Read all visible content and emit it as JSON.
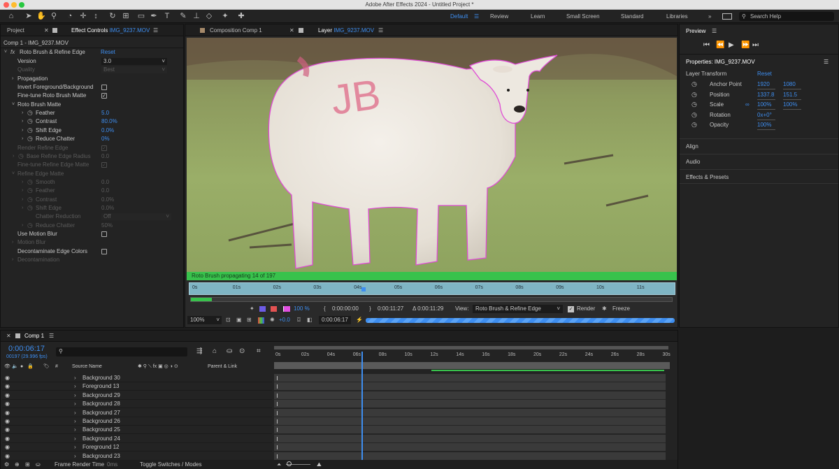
{
  "title_bar": {
    "title": "Adobe After Effects 2024 - Untitled Project *"
  },
  "toolbar": {
    "workspaces": [
      "Default",
      "Review",
      "Learn",
      "Small Screen",
      "Standard",
      "Libraries"
    ],
    "search_placeholder": "Search Help"
  },
  "effect_panel": {
    "tab_project": "Project",
    "tab_effect_controls": "Effect Controls",
    "tab_effect_file": "IMG_9237.MOV",
    "breadcrumb": "Comp 1 - IMG_9237.MOV",
    "effect_name": "Roto Brush & Refine Edge",
    "reset": "Reset",
    "rows": [
      {
        "label": "Version",
        "value": "3.0",
        "indent": 24,
        "type": "dropdown",
        "dim": false
      },
      {
        "label": "Quality",
        "value": "Best",
        "indent": 24,
        "type": "dropdown",
        "dim": true
      },
      {
        "label": "Propagation",
        "indent": 24,
        "type": "group",
        "dim": false
      },
      {
        "label": "Invert Foreground/Background",
        "indent": 24,
        "type": "check",
        "checked": false,
        "dim": false
      },
      {
        "label": "Fine-tune Roto Brush Matte",
        "indent": 24,
        "type": "check",
        "checked": true,
        "dim": false
      },
      {
        "label": "Roto Brush Matte",
        "indent": 24,
        "type": "group-open",
        "dim": false
      },
      {
        "label": "Feather",
        "value": "5.0",
        "indent": 50,
        "type": "stopwatch",
        "dim": false
      },
      {
        "label": "Contrast",
        "value": "80.0%",
        "indent": 50,
        "type": "stopwatch",
        "dim": false
      },
      {
        "label": "Shift Edge",
        "value": "0.0%",
        "indent": 50,
        "type": "stopwatch",
        "dim": false
      },
      {
        "label": "Reduce Chatter",
        "value": "0%",
        "indent": 50,
        "type": "stopwatch",
        "dim": false
      },
      {
        "label": "Render Refine Edge",
        "indent": 24,
        "type": "check",
        "checked": true,
        "dim": true
      },
      {
        "label": "Base Refine Edge Radius",
        "value": "0.0",
        "indent": 37,
        "type": "stopwatch-group",
        "dim": true
      },
      {
        "label": "Fine-tune Refine Edge Matte",
        "indent": 24,
        "type": "check",
        "checked": true,
        "dim": true
      },
      {
        "label": "Refine Edge Matte",
        "indent": 24,
        "type": "group-open",
        "dim": true
      },
      {
        "label": "Smooth",
        "value": "0.0",
        "indent": 50,
        "type": "stopwatch",
        "dim": true
      },
      {
        "label": "Feather",
        "value": "0.0",
        "indent": 50,
        "type": "stopwatch",
        "dim": true
      },
      {
        "label": "Contrast",
        "value": "0.0%",
        "indent": 50,
        "type": "stopwatch",
        "dim": true
      },
      {
        "label": "Shift Edge",
        "value": "0.0%",
        "indent": 50,
        "type": "stopwatch",
        "dim": true
      },
      {
        "label": "Chatter Reduction",
        "value": "Off",
        "indent": 50,
        "type": "dropdown",
        "dim": true
      },
      {
        "label": "Reduce Chatter",
        "value": "50%",
        "indent": 50,
        "type": "stopwatch",
        "dim": true
      },
      {
        "label": "Use Motion Blur",
        "indent": 24,
        "type": "check",
        "checked": false,
        "dim": false
      },
      {
        "label": "Motion Blur",
        "indent": 24,
        "type": "group",
        "dim": true
      },
      {
        "label": "Decontaminate Edge Colors",
        "indent": 24,
        "type": "check",
        "checked": false,
        "dim": false
      },
      {
        "label": "Decontamination",
        "indent": 24,
        "type": "group",
        "dim": true
      }
    ]
  },
  "viewer": {
    "tab_composition": "Composition Comp 1",
    "tab_layer_prefix": "Layer",
    "tab_layer_file": "IMG_9237.MOV",
    "progress_text": "Roto Brush propagating 14 of 197",
    "ruler_ticks": [
      "0s",
      "01s",
      "02s",
      "03s",
      "04s",
      "05s",
      "06s",
      "07s",
      "08s",
      "09s",
      "10s",
      "11s"
    ],
    "opacity": "100 %",
    "in_time": "0:00:00:00",
    "out_time": "0:00:11:27",
    "duration": "Δ 0:00:11:29",
    "view_label": "View:",
    "view_value": "Roto Brush & Refine Edge",
    "render": "Render",
    "freeze": "Freeze",
    "zoom": "100%",
    "exposure": "+0.0",
    "current_time": "0:00:06:17"
  },
  "right_panel": {
    "preview": "Preview",
    "properties_title": "Properties: IMG_9237.MOV",
    "layer_transform": "Layer Transform",
    "reset": "Reset",
    "props": [
      {
        "label": "Anchor Point",
        "v1": "1920",
        "v2": "1080"
      },
      {
        "label": "Position",
        "v1": "1337.8",
        "v2": "151.5"
      },
      {
        "label": "Scale",
        "v1": "100%",
        "v2": "100%"
      },
      {
        "label": "Rotation",
        "v1": "0x+0°",
        "v2": ""
      },
      {
        "label": "Opacity",
        "v1": "100%",
        "v2": ""
      }
    ],
    "sections": [
      "Align",
      "Audio",
      "Effects & Presets"
    ]
  },
  "timeline": {
    "tab": "Comp 1",
    "timecode": "0:00:06:17",
    "frame_info": "00197 (29.996 fps)",
    "search_placeholder": "",
    "col_hash": "#",
    "col_source": "Source Name",
    "col_parent": "Parent & Link",
    "ticks": [
      "0s",
      "02s",
      "04s",
      "06s",
      "08s",
      "10s",
      "12s",
      "14s",
      "16s",
      "18s",
      "20s",
      "22s",
      "24s",
      "26s",
      "28s",
      "30s"
    ],
    "layers": [
      "Background 30",
      "Foreground 13",
      "Background 29",
      "Background 28",
      "Background 27",
      "Background 26",
      "Background 25",
      "Background 24",
      "Foreground 12",
      "Background 23"
    ],
    "frame_render_time_label": "Frame Render Time",
    "frame_render_time_value": "0ms",
    "toggle_switches": "Toggle Switches / Modes"
  }
}
